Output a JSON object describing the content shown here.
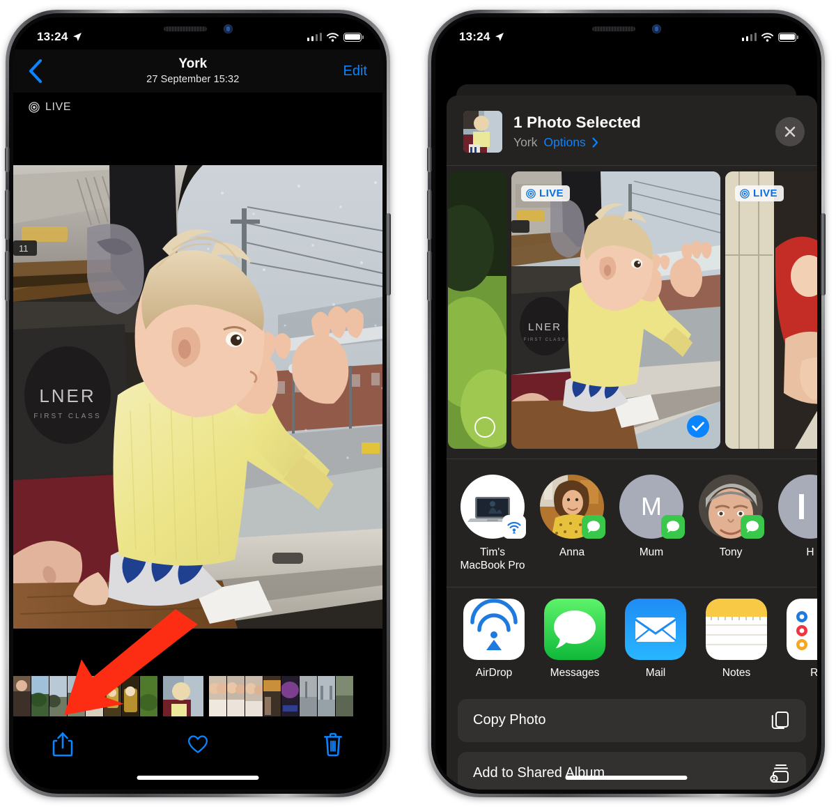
{
  "left_phone": {
    "status_bar": {
      "time": "13:24",
      "location_icon": "location-arrow-icon",
      "wifi_icon": "wifi-icon",
      "battery_icon": "battery-icon",
      "signal_icon": "cellular-signal-icon"
    },
    "nav": {
      "back_icon": "back-chevron-icon",
      "title": "York",
      "subtitle": "27 September  15:32",
      "edit_label": "Edit"
    },
    "live_badge": {
      "icon": "live-photo-icon",
      "label": "LIVE"
    },
    "photo": {
      "description": "Baby in yellow cardigan at train window, LNER First Class"
    },
    "toolbar": {
      "share_icon": "share-icon",
      "favorite_icon": "heart-icon",
      "delete_icon": "trash-icon",
      "accent_color": "#0a84ff"
    },
    "annotation": {
      "arrow_icon": "red-arrow-annotation",
      "color": "#fc2d12",
      "points_to": "share-icon"
    },
    "home_indicator": "home-indicator"
  },
  "right_phone": {
    "status_bar": {
      "time": "13:24",
      "location_icon": "location-arrow-icon",
      "wifi_icon": "wifi-icon",
      "battery_icon": "battery-icon",
      "signal_icon": "cellular-signal-icon"
    },
    "share_sheet": {
      "header": {
        "title": "1 Photo Selected",
        "album": "York",
        "options_label": "Options",
        "chevron_icon": "chevron-right-icon",
        "close_icon": "close-icon"
      },
      "carousel": [
        {
          "selected": false,
          "live": false,
          "description": "green grass photo"
        },
        {
          "selected": true,
          "live": true,
          "live_label": "LIVE",
          "description": "baby at train window"
        },
        {
          "selected": false,
          "live": true,
          "live_label": "LIVE",
          "description": "woman in red dress"
        }
      ],
      "people": [
        {
          "name": "Tim's MacBook Pro",
          "badge": "airdrop-icon",
          "avatar": "macbook-avatar"
        },
        {
          "name": "Anna",
          "badge": "messages-icon",
          "avatar": "photo-avatar"
        },
        {
          "name": "Mum",
          "badge": "messages-icon",
          "avatar": "initial-avatar",
          "initial": "M"
        },
        {
          "name": "Tony",
          "badge": "messages-icon",
          "avatar": "photo-avatar"
        },
        {
          "name": "H",
          "badge": "messages-icon",
          "avatar": "initial-avatar",
          "initial": ""
        }
      ],
      "apps": [
        {
          "name": "AirDrop",
          "icon": "airdrop-app-icon"
        },
        {
          "name": "Messages",
          "icon": "messages-app-icon"
        },
        {
          "name": "Mail",
          "icon": "mail-app-icon"
        },
        {
          "name": "Notes",
          "icon": "notes-app-icon"
        },
        {
          "name": "Re",
          "icon": "reminders-app-icon"
        }
      ],
      "actions": [
        {
          "label": "Copy Photo",
          "icon": "copy-icon"
        },
        {
          "label": "Add to Shared Album",
          "icon": "shared-album-icon"
        }
      ]
    },
    "home_indicator": "home-indicator"
  },
  "colors": {
    "accent_blue": "#0a84ff",
    "sheet_bg": "#252222",
    "row_bg": "#333030",
    "arrow_red": "#fc2d12",
    "messages_green": "#39c84b"
  }
}
